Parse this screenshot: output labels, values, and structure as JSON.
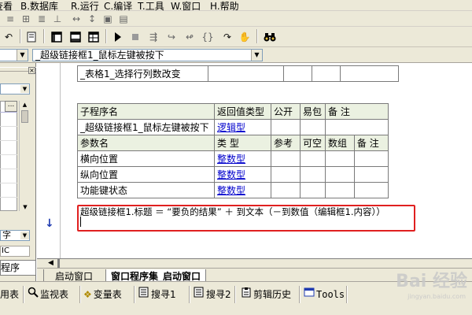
{
  "menu": {
    "items": [
      "查看",
      "B.数据库",
      "R.运行",
      "C.编译",
      "T.工具",
      "W.窗口",
      "H.帮助"
    ]
  },
  "selectors": {
    "left_value": "",
    "subroutine": "_超级链接框1_鼠标左键被按下"
  },
  "left_panel": {
    "dots": "...",
    "label_a": "字",
    "label_b": "IC",
    "label_c": "程序"
  },
  "event_table": {
    "row": "_表格1_选择行列数改变"
  },
  "sub_table": {
    "headers": [
      "子程序名",
      "返回值类型",
      "公开",
      "易包",
      "备 注"
    ],
    "row": {
      "name": "_超级链接框1_鼠标左键被按下",
      "return_type": "逻辑型",
      "public": "",
      "easy": "",
      "note": ""
    }
  },
  "param_table": {
    "headers": [
      "参数名",
      "类 型",
      "参考",
      "可空",
      "数组",
      "备 注"
    ],
    "rows": [
      {
        "name": "横向位置",
        "type": "整数型"
      },
      {
        "name": "纵向位置",
        "type": "整数型"
      },
      {
        "name": "功能键状态",
        "type": "整数型"
      }
    ]
  },
  "code": {
    "line1": "超级链接框1.标题 ＝ “要负的结果” ＋ 到文本（－到数值（编辑框1.内容））",
    "line2": ""
  },
  "tabs": {
    "tab1": "_启动窗口",
    "tab2": "窗口程序集_启动窗口"
  },
  "bottom": {
    "items": [
      "用表",
      "监视表",
      "变量表",
      "搜寻1",
      "搜寻2",
      "剪辑历史",
      "Tools"
    ]
  },
  "watermark": {
    "text": "Bai 经验",
    "sub": "jingyan.baidu.com"
  },
  "colors": {
    "chrome": "#ece9d8",
    "table_header": "#ebf1e1",
    "link": "#0000cc",
    "highlight_border": "#e02020",
    "arrow": "#1f3bb0"
  }
}
